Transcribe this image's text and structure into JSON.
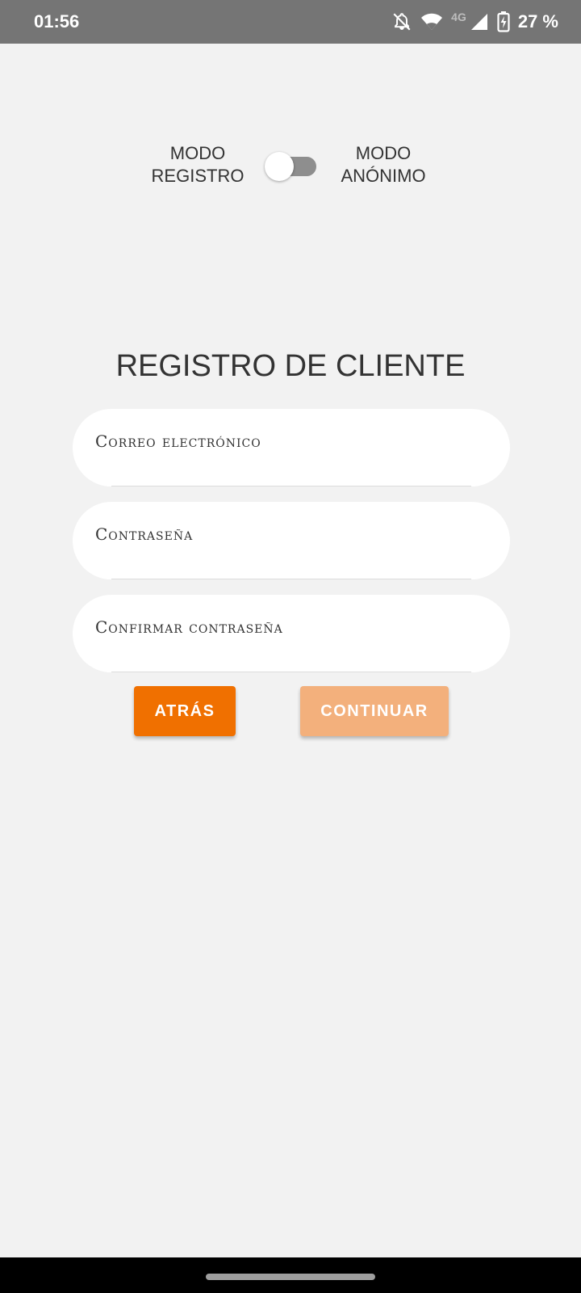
{
  "status_bar": {
    "time": "01:56",
    "network_label": "4G",
    "battery_text": "27 %",
    "icons": [
      "bell-off-icon",
      "wifi-icon",
      "signal-icon",
      "battery-charging-icon"
    ]
  },
  "mode_toggle": {
    "left_label": "MODO\nREGISTRO",
    "right_label": "MODO\nANÓNIMO",
    "state": "off"
  },
  "title": "REGISTRO DE CLIENTE",
  "form": {
    "email_placeholder": "Correo electrónico",
    "password_placeholder": "Contraseña",
    "confirm_placeholder": "Confirmar contraseña"
  },
  "buttons": {
    "back_label": "ATRÁS",
    "continue_label": "CONTINUAR"
  },
  "colors": {
    "accent": "#f07000",
    "accent_disabled": "#f3b07c",
    "status_bar": "#757575",
    "background": "#f2f2f2"
  }
}
